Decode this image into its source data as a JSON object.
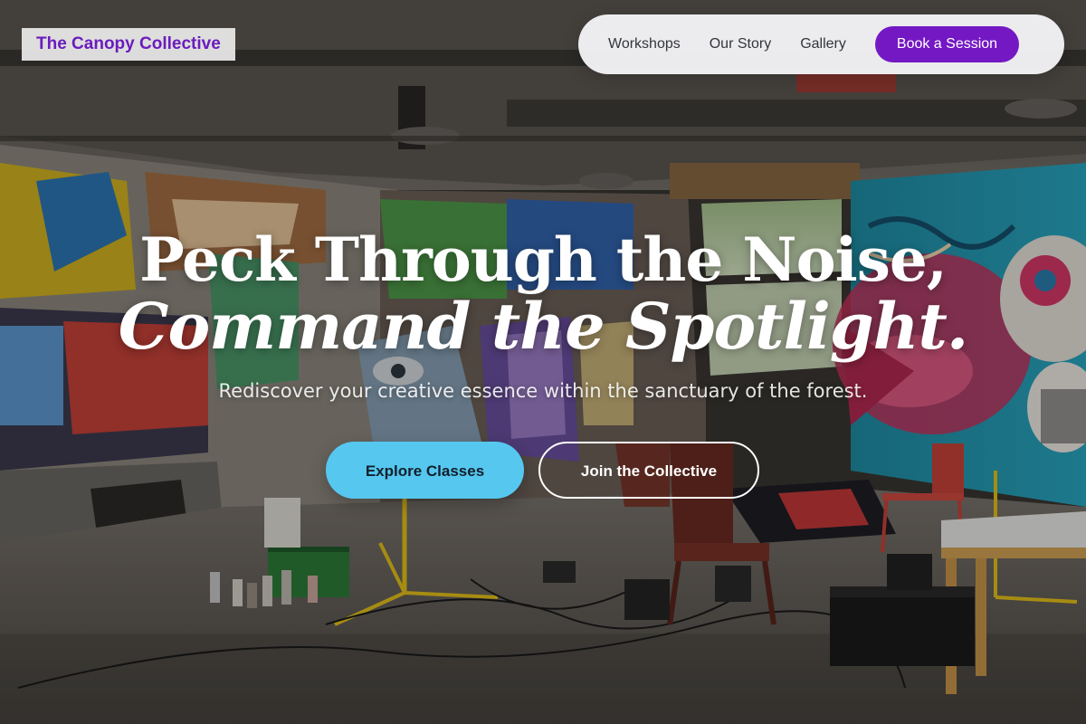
{
  "brand": {
    "name": "The Canopy Collective",
    "color": "#6b1cbd"
  },
  "nav": {
    "links": [
      {
        "label": "Workshops"
      },
      {
        "label": "Our Story"
      },
      {
        "label": "Gallery"
      }
    ],
    "cta_label": "Book a Session",
    "cta_color": "#7418c4"
  },
  "hero": {
    "headline_line1": "Peck Through the Noise,",
    "headline_line2": "Command the Spotlight.",
    "subtitle": "Rediscover your creative essence within the sanctuary of the forest.",
    "primary_button": "Explore Classes",
    "primary_color": "#56c7ef",
    "secondary_button": "Join the Collective"
  }
}
